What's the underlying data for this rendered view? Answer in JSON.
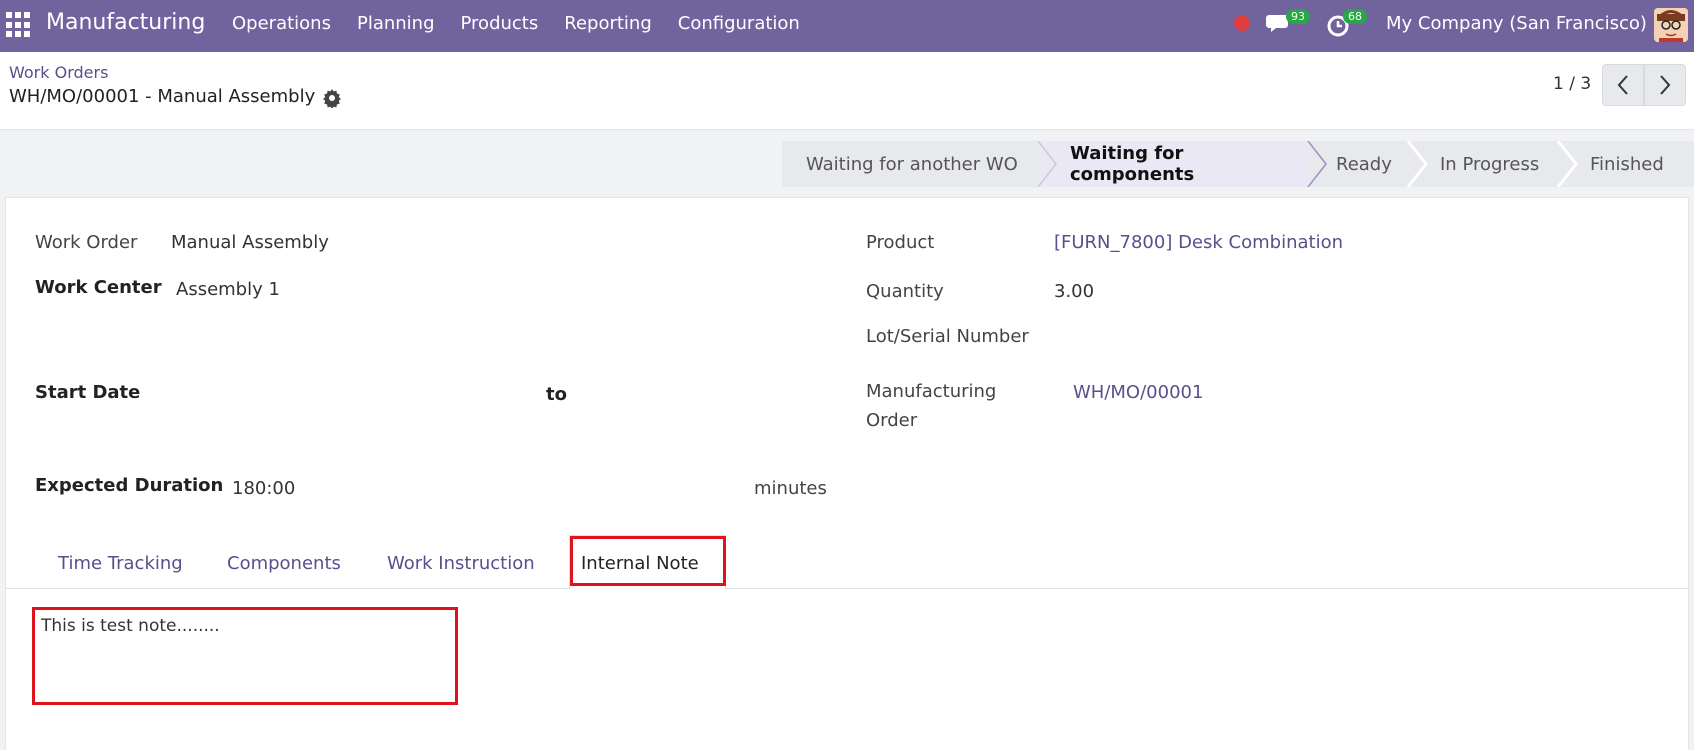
{
  "navbar": {
    "brand": "Manufacturing",
    "menu": [
      "Operations",
      "Planning",
      "Products",
      "Reporting",
      "Configuration"
    ],
    "messages_count": "93",
    "activities_count": "68",
    "company": "My Company (San Francisco)"
  },
  "control_panel": {
    "breadcrumb_parent": "Work Orders",
    "breadcrumb_current": "WH/MO/00001 - Manual Assembly",
    "pager": "1 / 3"
  },
  "statusbar": {
    "stages": [
      "Waiting for another WO",
      "Waiting for components",
      "Ready",
      "In Progress",
      "Finished"
    ],
    "active": "Waiting for components"
  },
  "form": {
    "work_order_label": "Work Order",
    "work_order_value": "Manual Assembly",
    "work_center_label": "Work Center",
    "work_center_value": "Assembly 1",
    "start_date_label": "Start Date",
    "to_label": "to",
    "expected_duration_label": "Expected Duration",
    "expected_duration_value": "180:00",
    "minutes_label": "minutes",
    "product_label": "Product",
    "product_value": "[FURN_7800] Desk Combination",
    "quantity_label": "Quantity",
    "quantity_value": "3.00",
    "lot_label": "Lot/Serial Number",
    "mo_label_1": "Manufacturing",
    "mo_label_2": "Order",
    "mo_value": "WH/MO/00001"
  },
  "tabs": [
    "Time Tracking",
    "Components",
    "Work Instruction",
    "Internal Note"
  ],
  "internal_note": "This is test note........",
  "colors": {
    "navbar": "#71639e",
    "link": "#5b4e8c",
    "highlight": "#e0121c"
  }
}
